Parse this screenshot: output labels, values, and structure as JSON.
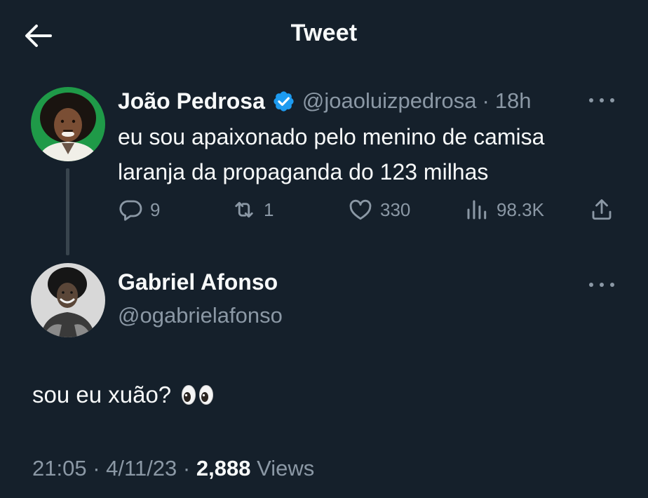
{
  "header": {
    "title": "Tweet",
    "back_icon": "arrow-left-icon"
  },
  "parent_tweet": {
    "display_name": "João Pedrosa",
    "verified": true,
    "handle": "@joaoluizpedrosa",
    "separator": "·",
    "time": "18h",
    "text": "eu sou apaixonado pelo menino de camisa\nlaranja da propaganda do 123 milhas",
    "stats": {
      "replies": "9",
      "retweets": "1",
      "likes": "330",
      "views": "98.3K"
    }
  },
  "reply": {
    "display_name": "Gabriel Afonso",
    "handle": "@ogabrielafonso",
    "text": "sou eu xuão?",
    "emoji": "eyes-emoji",
    "timestamp": "21:05",
    "separator": "·",
    "date": "4/11/23",
    "views_count": "2,888",
    "views_label": "Views"
  },
  "colors": {
    "background": "#15202b",
    "primary_text": "#f7f9f9",
    "secondary_text": "#8b98a5",
    "verified": "#1d9bf0",
    "thread_line": "#38444d"
  }
}
